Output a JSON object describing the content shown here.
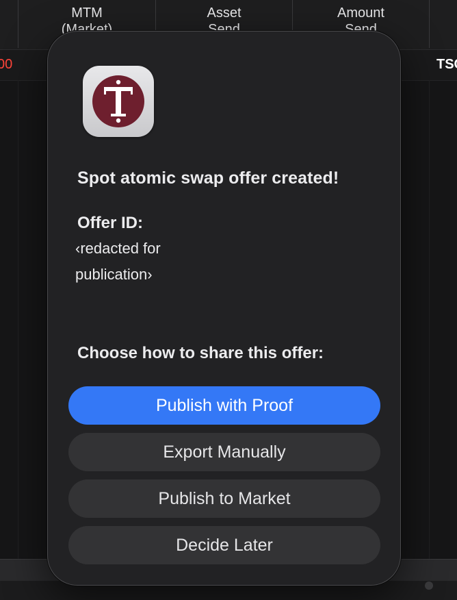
{
  "background_table": {
    "columns": [
      {
        "line1": "MTM",
        "line2": "(Market)"
      },
      {
        "line1": "Asset",
        "line2": "Send"
      },
      {
        "line1": "Amount",
        "line2": "Send"
      }
    ],
    "row": {
      "left_value": "00",
      "right_value": "TSC"
    }
  },
  "dialog": {
    "icon": "app-logo-t",
    "icon_letter": "T",
    "title": "Spot atomic swap offer created!",
    "offer_id_label": "Offer ID:",
    "offer_id_value": "‹redacted for publication›",
    "share_prompt": "Choose how to share this offer:",
    "buttons": {
      "publish_proof": "Publish with Proof",
      "export_manually": "Export Manually",
      "publish_market": "Publish to Market",
      "decide_later": "Decide Later"
    }
  },
  "colors": {
    "accent": "#3478f6",
    "logo_maroon": "#6e1f2e",
    "negative": "#ff453a"
  }
}
